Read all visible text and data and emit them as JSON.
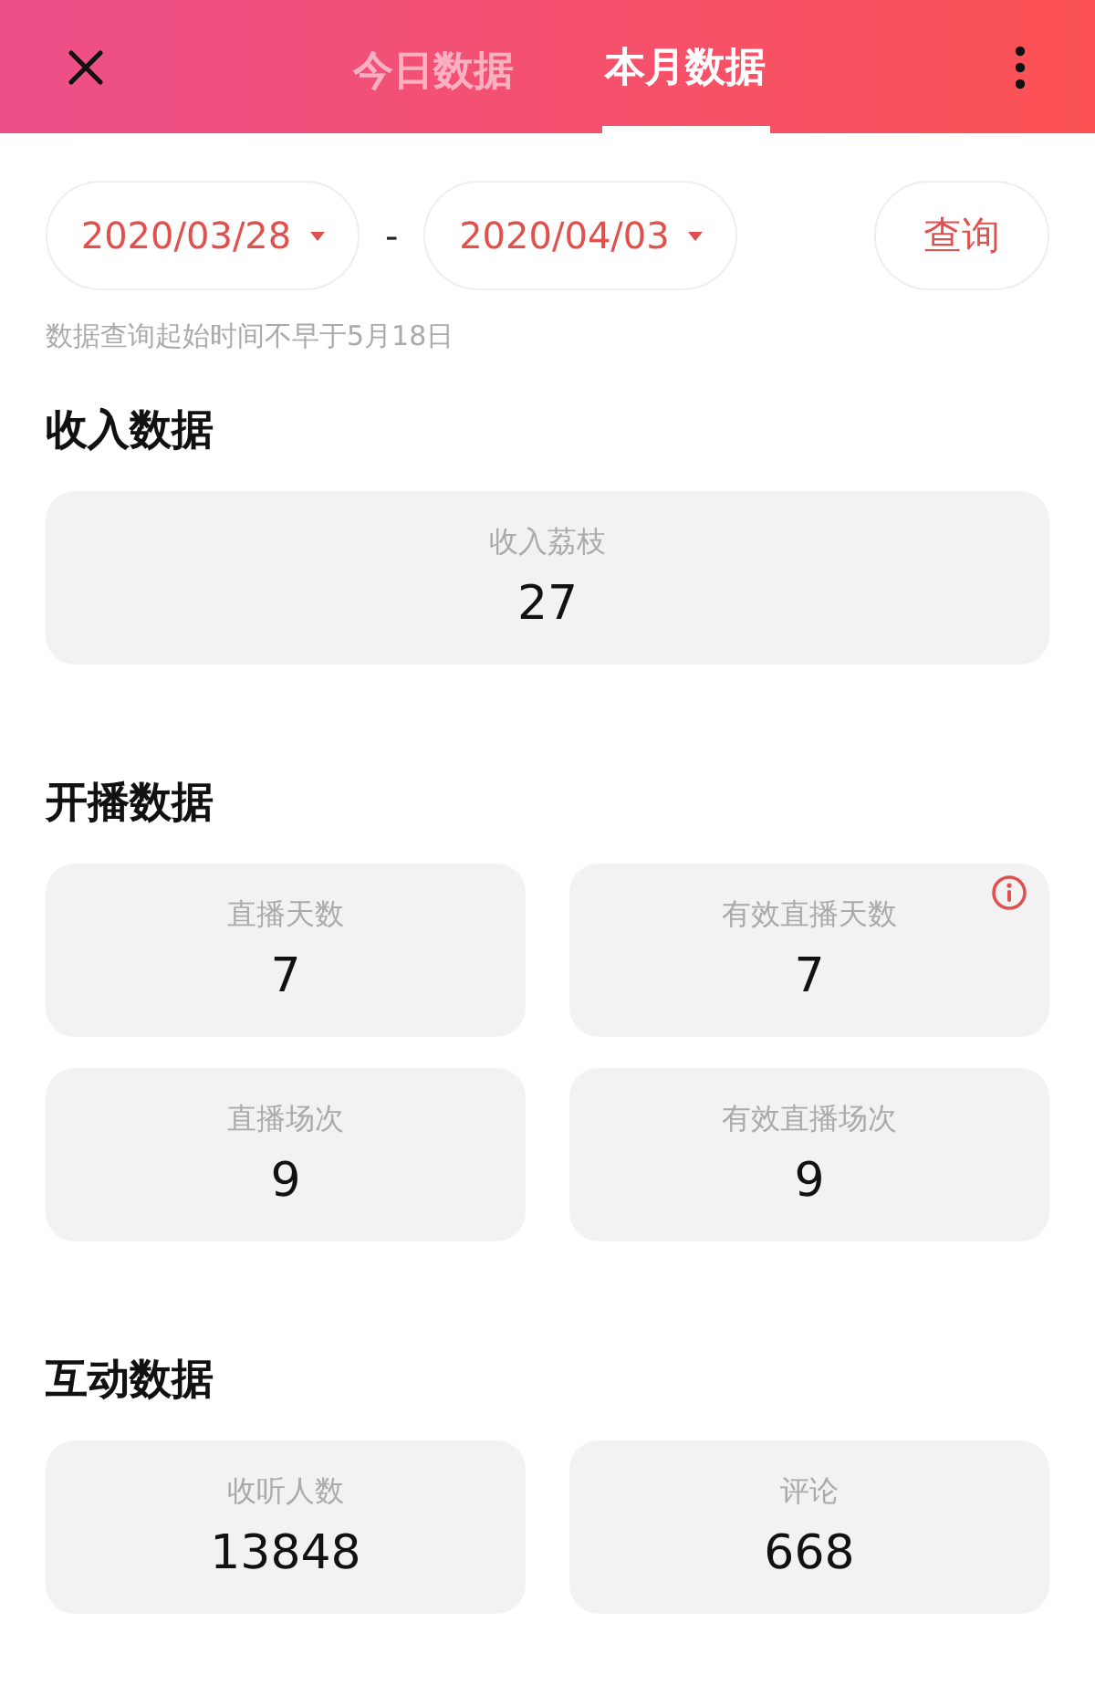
{
  "tabs": [
    {
      "label": "今日数据",
      "selected": false
    },
    {
      "label": "本月数据",
      "selected": true
    }
  ],
  "date_range": {
    "start": "2020/03/28",
    "separator": "-",
    "end": "2020/04/03",
    "query_button": "查询",
    "hint": "数据查询起始时间不早于5月18日"
  },
  "sections": [
    {
      "title": "收入数据",
      "cards": [
        {
          "label": "收入荔枝",
          "value": "27",
          "info": false
        }
      ]
    },
    {
      "title": "开播数据",
      "cards": [
        {
          "label": "直播天数",
          "value": "7",
          "info": false
        },
        {
          "label": "有效直播天数",
          "value": "7",
          "info": true
        },
        {
          "label": "直播场次",
          "value": "9",
          "info": false
        },
        {
          "label": "有效直播场次",
          "value": "9",
          "info": false
        }
      ]
    },
    {
      "title": "互动数据",
      "cards": [
        {
          "label": "收听人数",
          "value": "13848",
          "info": false
        },
        {
          "label": "评论",
          "value": "668",
          "info": false
        }
      ]
    }
  ]
}
